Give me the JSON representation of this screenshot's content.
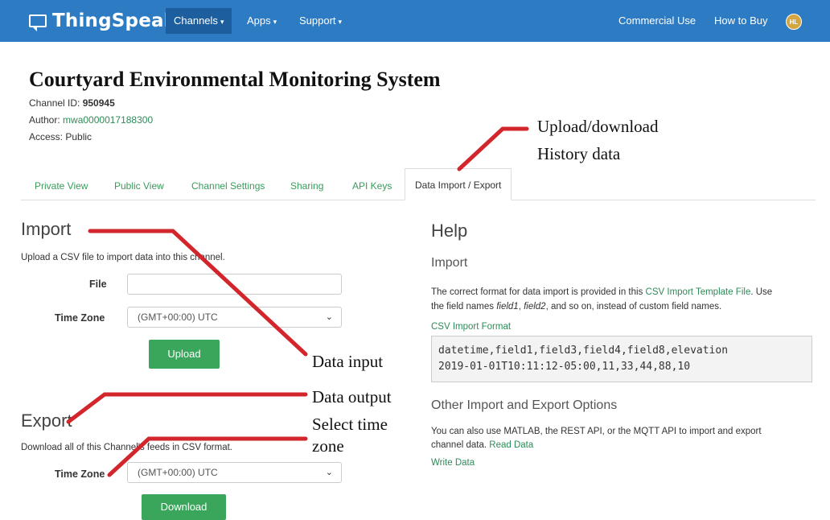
{
  "navbar": {
    "brand": "ThingSpeak",
    "brand_tm": "™",
    "items": [
      {
        "label": "Channels",
        "caret": "▾",
        "active": true
      },
      {
        "label": "Apps",
        "caret": "▾"
      },
      {
        "label": "Support",
        "caret": "▾"
      }
    ],
    "right": [
      "Commercial Use",
      "How to Buy"
    ],
    "avatar": "HL",
    "color": "#2d7cc3"
  },
  "channel": {
    "title": "Courtyard Environmental Monitoring System",
    "id_label": "Channel ID: ",
    "id_value": "950945",
    "author_label": "Author: ",
    "author_value": "mwa0000017188300",
    "access": "Access: Public"
  },
  "tabs": [
    "Private View",
    "Public View",
    "Channel Settings",
    "Sharing",
    "API Keys",
    "Data Import / Export"
  ],
  "import": {
    "heading": "Import",
    "description": "Upload a CSV file to import data into this channel.",
    "file_label": "File",
    "file_value": "",
    "timezone_label": "Time Zone",
    "timezone_value": "(GMT+00:00) UTC",
    "upload_button": "Upload"
  },
  "export": {
    "heading": "Export",
    "description": "Download all of this Channel's feeds in CSV format.",
    "timezone_label": "Time Zone",
    "timezone_value": "(GMT+00:00) UTC",
    "download_button": "Download"
  },
  "help": {
    "heading": "Help",
    "import_heading": "Import",
    "text_1a": "The correct format for data import is provided in this ",
    "text_1_link": "CSV Import Template File",
    "text_1b": ". Use",
    "text_2a": "the field names ",
    "text_2_f1": "field1",
    "text_2_comma": ", ",
    "text_2_f2": "field2",
    "text_2b": ", and so on, instead of custom field names.",
    "csv_format_link": "CSV Import Format",
    "code_line_1": "datetime,field1,field3,field4,field8,elevation",
    "code_line_2": "2019-01-01T10:11:12-05:00,11,33,44,88,10",
    "other_heading": "Other Import and Export Options",
    "other_text_1": "You can also use MATLAB, the REST API, or the MQTT API to import and export",
    "other_text_2a": "channel data. ",
    "read_data_link": "Read Data",
    "write_data_link": "Write Data"
  },
  "annotations": {
    "upload_download": "Upload/download",
    "history_data": "History data",
    "data_input": "Data input",
    "data_output": "Data output",
    "select_time": "Select time",
    "zone": "zone",
    "line_color": "#d3262c"
  }
}
